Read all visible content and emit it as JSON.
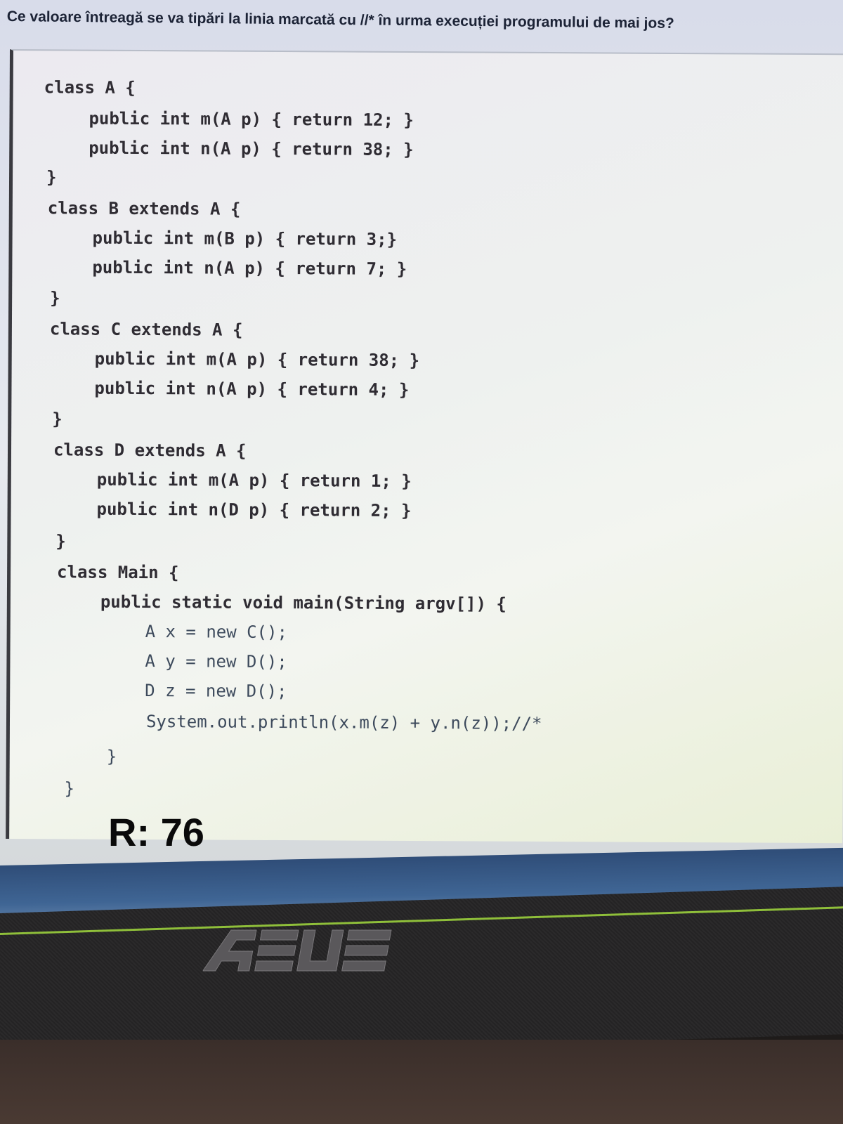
{
  "question": "Ce valoare întreagă se va tipări la linia marcată cu //* în urma execuției programului de mai jos?",
  "code_lines": [
    "class A {",
    "public int m(A p) { return 12; }",
    "public int n(A p) { return 38; }",
    "}",
    "class B extends A {",
    "public int m(B p) { return 3;}",
    "public int n(A p) { return 7; }",
    "}",
    "class C extends A {",
    "public int m(A p) { return 38; }",
    "public int n(A p) { return 4; }",
    "}",
    "class D extends A {",
    "public int m(A p) { return 1; }",
    "public int n(D p) { return 2; }",
    "}",
    "class Main {",
    "public static void main(String argv[]) {",
    "A x = new C();",
    "A y = new D();",
    "D z = new D();",
    "System.out.println(x.m(z) + y.n(z));//*",
    "}",
    "}"
  ],
  "answer": "R: 76",
  "brand": "ASUS",
  "colors": {
    "code_text": "#2f2c33",
    "answer_text": "#0a0a0a",
    "taskbar": "#3f6594"
  }
}
